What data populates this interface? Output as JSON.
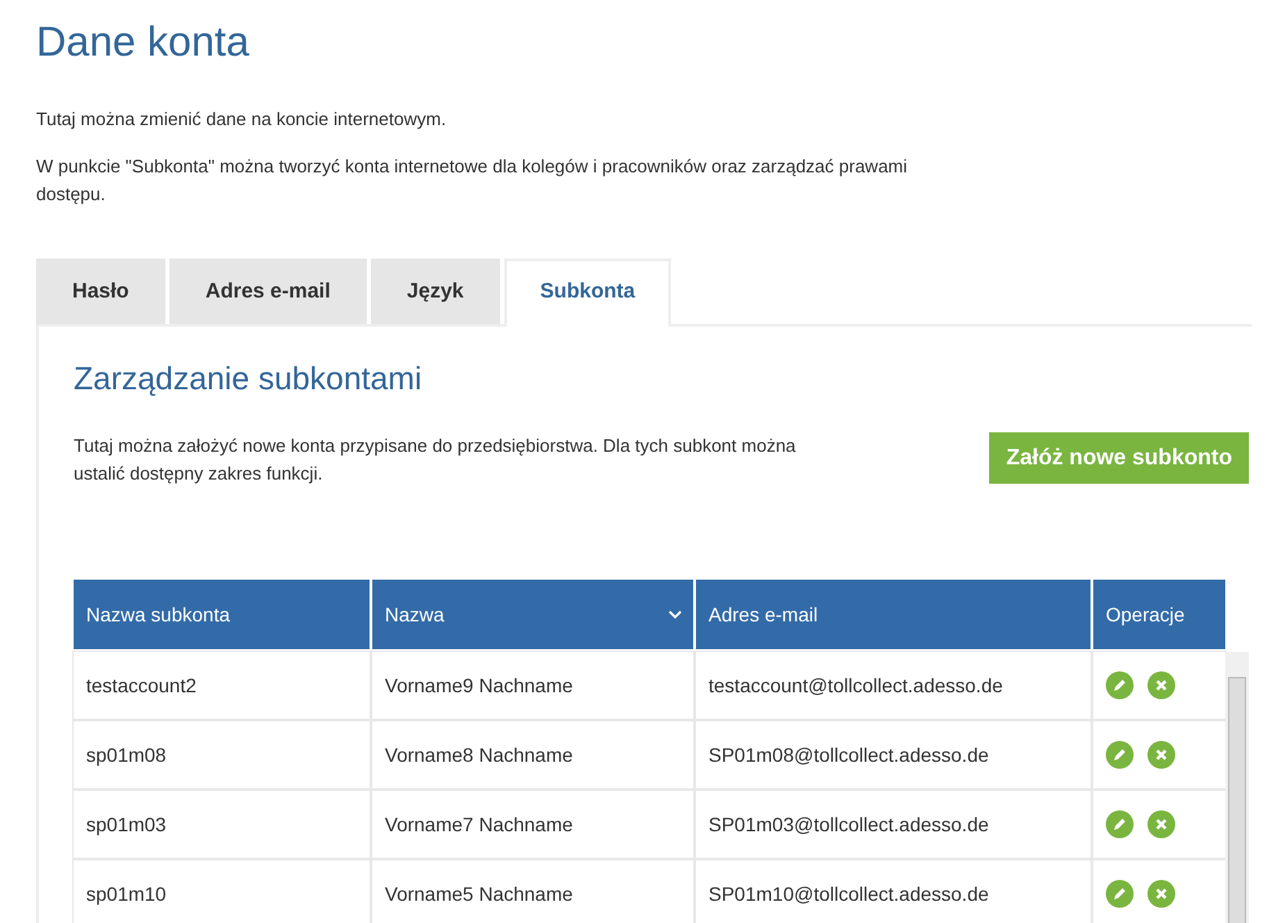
{
  "title": "Dane konta",
  "intro": [
    "Tutaj można zmienić dane na koncie internetowym.",
    "W punkcie \"Subkonta\" można tworzyć konta internetowe dla kolegów i pracowników oraz zarządzać prawami dostępu."
  ],
  "tabs": [
    {
      "label": "Hasło",
      "selected": false
    },
    {
      "label": "Adres e-mail",
      "selected": false
    },
    {
      "label": "Język",
      "selected": false
    },
    {
      "label": "Subkonta",
      "selected": true
    }
  ],
  "section": {
    "title": "Zarządzanie subkontami",
    "description": "Tutaj można założyć nowe konta przypisane do przedsiębiorstwa. Dla tych subkont można ustalić dostępny zakres funkcji.",
    "button": "Załóż nowe subkonto"
  },
  "table": {
    "columns": [
      {
        "label": "Nazwa subkonta",
        "sorted": false
      },
      {
        "label": "Nazwa",
        "sorted": true
      },
      {
        "label": "Adres e-mail",
        "sorted": false
      },
      {
        "label": "Operacje",
        "sorted": false
      }
    ],
    "rows": [
      [
        "testaccount2",
        "Vorname9 Nachname",
        "testaccount@tollcollect.adesso.de"
      ],
      [
        "sp01m08",
        "Vorname8 Nachname",
        "SP01m08@tollcollect.adesso.de"
      ],
      [
        "sp01m03",
        "Vorname7 Nachname",
        "SP01m03@tollcollect.adesso.de"
      ],
      [
        "sp01m10",
        "Vorname5 Nachname",
        "SP01m10@tollcollect.adesso.de"
      ]
    ]
  }
}
